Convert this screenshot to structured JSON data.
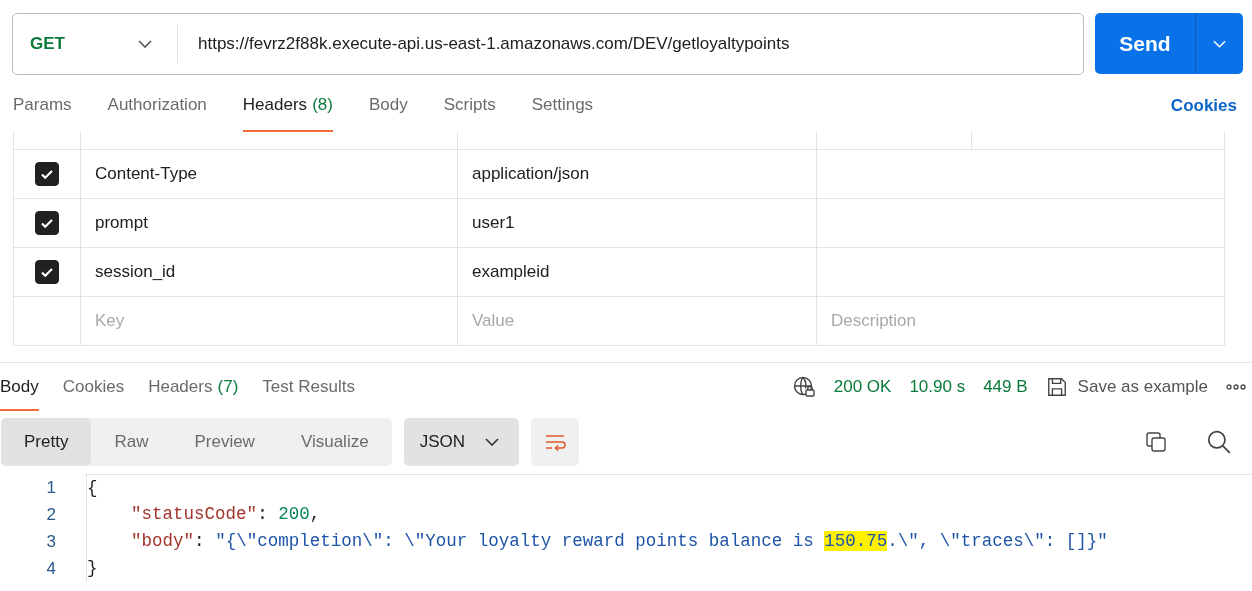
{
  "request": {
    "method": "GET",
    "url": "https://fevrz2f88k.execute-api.us-east-1.amazonaws.com/DEV/getloyaltypoints",
    "send": "Send"
  },
  "request_tabs": [
    {
      "label": "Params",
      "selected": false
    },
    {
      "label": "Authorization",
      "selected": false
    },
    {
      "label": "Headers",
      "count": "(8)",
      "selected": true
    },
    {
      "label": "Body",
      "selected": false
    },
    {
      "label": "Scripts",
      "selected": false
    },
    {
      "label": "Settings",
      "selected": false
    }
  ],
  "cookies_link": "Cookies",
  "headers": [
    {
      "checked": true,
      "key": "Content-Type",
      "value": "application/json"
    },
    {
      "checked": true,
      "key": "prompt",
      "value": "user1"
    },
    {
      "checked": true,
      "key": "session_id",
      "value": "exampleid"
    }
  ],
  "new_header": {
    "key_placeholder": "Key",
    "value_placeholder": "Value",
    "description_placeholder": "Description"
  },
  "response_tabs": [
    {
      "label": "Body",
      "selected": true
    },
    {
      "label": "Cookies",
      "selected": false
    },
    {
      "label": "Headers",
      "count": "(7)",
      "selected": false
    },
    {
      "label": "Test Results",
      "selected": false
    }
  ],
  "status": {
    "code": "200 OK",
    "time": "10.90 s",
    "size": "449 B",
    "save": "Save as example"
  },
  "format_tabs": [
    {
      "label": "Pretty",
      "selected": true
    },
    {
      "label": "Raw",
      "selected": false
    },
    {
      "label": "Preview",
      "selected": false
    },
    {
      "label": "Visualize",
      "selected": false
    }
  ],
  "language": "JSON",
  "code_lines": [
    {
      "number": "1",
      "tokens": [
        {
          "kind": "punct",
          "text": "{"
        }
      ]
    },
    {
      "number": "2",
      "indented": true,
      "tokens": [
        {
          "kind": "key",
          "text": "\"statusCode\""
        },
        {
          "kind": "punct",
          "text": ": "
        },
        {
          "kind": "number",
          "text": "200"
        },
        {
          "kind": "punct",
          "text": ","
        }
      ]
    },
    {
      "number": "3",
      "indented": true,
      "tokens": [
        {
          "kind": "key",
          "text": "\"body\""
        },
        {
          "kind": "punct",
          "text": ": "
        },
        {
          "kind": "string",
          "text": "\"{\\\"completion\\\": \\\"Your loyalty reward points balance is "
        },
        {
          "kind": "highlight",
          "text": "150.75"
        },
        {
          "kind": "string",
          "text": ".\\\", \\\"traces\\\": []}\""
        }
      ]
    },
    {
      "number": "4",
      "tokens": [
        {
          "kind": "punct",
          "text": "}"
        }
      ]
    }
  ]
}
